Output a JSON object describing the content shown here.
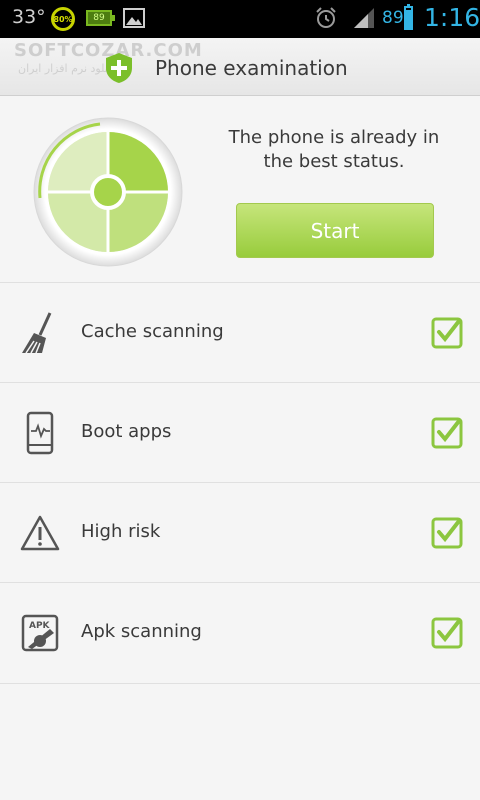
{
  "status_bar": {
    "temperature": "33°",
    "ring_percent": "80%",
    "battery_app": "89",
    "battery_level": "89",
    "time": "1:16"
  },
  "watermark": {
    "text": "SOFTCOZAR.COM",
    "subtext": "دانلود نرم افزار ایران"
  },
  "titlebar": {
    "title": "Phone examination"
  },
  "summary": {
    "status_text": "The phone is already in the best status.",
    "start_label": "Start"
  },
  "items": [
    {
      "label": "Cache scanning",
      "icon": "broom-icon",
      "checked": true
    },
    {
      "label": "Boot apps",
      "icon": "phone-pulse-icon",
      "checked": true
    },
    {
      "label": "High risk",
      "icon": "warning-icon",
      "checked": true
    },
    {
      "label": "Apk scanning",
      "icon": "apk-icon",
      "checked": true
    }
  ],
  "colors": {
    "accent_green": "#98cc3c",
    "status_blue": "#33b5e5",
    "text": "#3a3a3a"
  }
}
